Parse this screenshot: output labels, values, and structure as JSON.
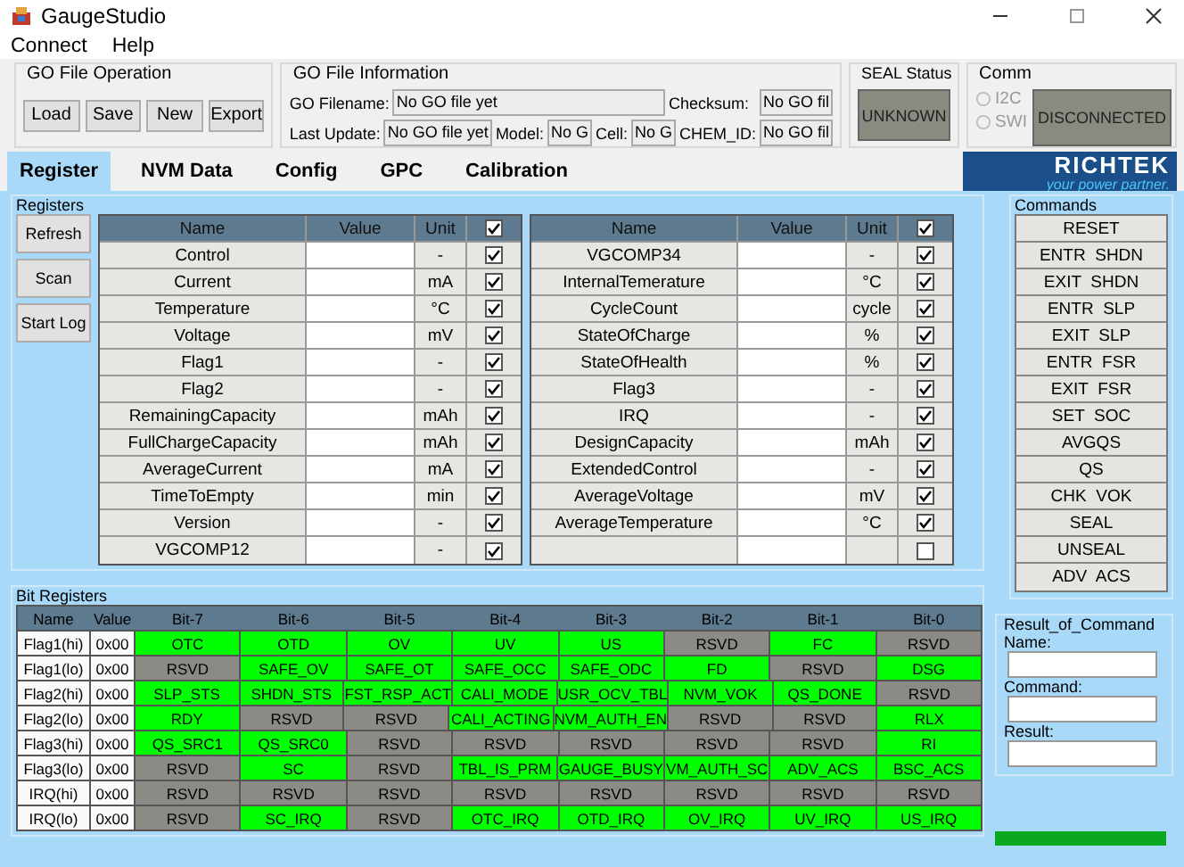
{
  "window": {
    "title": "GaugeStudio"
  },
  "menu": [
    "Connect",
    "Help"
  ],
  "go_file_operation": {
    "title": "GO File Operation",
    "buttons": [
      "Load",
      "Save",
      "New",
      "Export"
    ]
  },
  "go_file_information": {
    "title": "GO File Information",
    "lines": [
      [
        {
          "label": "GO Filename:",
          "value": "No GO file yet"
        },
        {
          "label": "Checksum:",
          "value": "No GO fil"
        }
      ],
      [
        {
          "label": "Last Update:",
          "value": "No GO file yet"
        },
        {
          "label": "Model:",
          "value": "No G"
        },
        {
          "label": "Cell:",
          "value": "No G"
        },
        {
          "label": "CHEM_ID:",
          "value": "No GO fil"
        }
      ]
    ]
  },
  "seal_status": {
    "title": "SEAL Status",
    "value": "UNKNOWN"
  },
  "comm": {
    "title": "Comm",
    "options": [
      {
        "label": "I2C",
        "selected": false,
        "disabled": true
      },
      {
        "label": "SWI",
        "selected": false,
        "disabled": true
      }
    ],
    "status": "DISCONNECTED"
  },
  "tabs": [
    {
      "label": "Register",
      "selected": true
    },
    {
      "label": "NVM Data",
      "selected": false
    },
    {
      "label": "Config",
      "selected": false
    },
    {
      "label": "GPC",
      "selected": false
    },
    {
      "label": "Calibration",
      "selected": false
    }
  ],
  "logo": {
    "name": "RICHTEK",
    "tagline": "your power partner."
  },
  "registers": {
    "title": "Registers",
    "buttons": [
      "Refresh",
      "Scan",
      "Start Log"
    ],
    "tables": [
      {
        "columns": [
          "Name",
          "Value",
          "Unit"
        ],
        "all_checked": true,
        "rows": [
          {
            "name": "Control",
            "unit": "-",
            "checked": true
          },
          {
            "name": "Current",
            "unit": "mA",
            "checked": true
          },
          {
            "name": "Temperature",
            "unit": "°C",
            "checked": true
          },
          {
            "name": "Voltage",
            "unit": "mV",
            "checked": true
          },
          {
            "name": "Flag1",
            "unit": "-",
            "checked": true
          },
          {
            "name": "Flag2",
            "unit": "-",
            "checked": true
          },
          {
            "name": "RemainingCapacity",
            "unit": "mAh",
            "checked": true
          },
          {
            "name": "FullChargeCapacity",
            "unit": "mAh",
            "checked": true
          },
          {
            "name": "AverageCurrent",
            "unit": "mA",
            "checked": true
          },
          {
            "name": "TimeToEmpty",
            "unit": "min",
            "checked": true
          },
          {
            "name": "Version",
            "unit": "-",
            "checked": true
          },
          {
            "name": "VGCOMP12",
            "unit": "-",
            "checked": true
          }
        ]
      },
      {
        "columns": [
          "Name",
          "Value",
          "Unit"
        ],
        "all_checked": true,
        "rows": [
          {
            "name": "VGCOMP34",
            "unit": "-",
            "checked": true
          },
          {
            "name": "InternalTemerature",
            "unit": "°C",
            "checked": true
          },
          {
            "name": "CycleCount",
            "unit": "cycle",
            "checked": true
          },
          {
            "name": "StateOfCharge",
            "unit": "%",
            "checked": true
          },
          {
            "name": "StateOfHealth",
            "unit": "%",
            "checked": true
          },
          {
            "name": "Flag3",
            "unit": "-",
            "checked": true
          },
          {
            "name": "IRQ",
            "unit": "-",
            "checked": true
          },
          {
            "name": "DesignCapacity",
            "unit": "mAh",
            "checked": true
          },
          {
            "name": "ExtendedControl",
            "unit": "-",
            "checked": true
          },
          {
            "name": "AverageVoltage",
            "unit": "mV",
            "checked": true
          },
          {
            "name": "AverageTemperature",
            "unit": "°C",
            "checked": true
          },
          {
            "checked": false
          }
        ]
      }
    ]
  },
  "commands": {
    "title": "Commands",
    "buttons": [
      "RESET",
      "ENTR  SHDN",
      "EXIT  SHDN",
      "ENTR  SLP",
      "EXIT  SLP",
      "ENTR  FSR",
      "EXIT  FSR",
      "SET  SOC",
      "AVGQS",
      "QS",
      "CHK  VOK",
      "SEAL",
      "UNSEAL",
      "ADV  ACS"
    ]
  },
  "bit_registers": {
    "title": "Bit Registers",
    "columns": [
      "Name",
      "Value",
      "Bit-7",
      "Bit-6",
      "Bit-5",
      "Bit-4",
      "Bit-3",
      "Bit-2",
      "Bit-1",
      "Bit-0"
    ],
    "rows": [
      {
        "name": "Flag1(hi)",
        "value": "0x00",
        "bits": [
          {
            "label": "OTC",
            "active": true
          },
          {
            "label": "OTD",
            "active": true
          },
          {
            "label": "OV",
            "active": true
          },
          {
            "label": "UV",
            "active": true
          },
          {
            "label": "US",
            "active": true
          },
          {
            "label": "RSVD",
            "active": false
          },
          {
            "label": "FC",
            "active": true
          },
          {
            "label": "RSVD",
            "active": false
          }
        ]
      },
      {
        "name": "Flag1(lo)",
        "value": "0x00",
        "bits": [
          {
            "label": "RSVD",
            "active": false
          },
          {
            "label": "SAFE_OV",
            "active": true
          },
          {
            "label": "SAFE_OT",
            "active": true
          },
          {
            "label": "SAFE_OCC",
            "active": true
          },
          {
            "label": "SAFE_ODC",
            "active": true
          },
          {
            "label": "FD",
            "active": true
          },
          {
            "label": "RSVD",
            "active": false
          },
          {
            "label": "DSG",
            "active": true
          }
        ]
      },
      {
        "name": "Flag2(hi)",
        "value": "0x00",
        "bits": [
          {
            "label": "SLP_STS",
            "active": true
          },
          {
            "label": "SHDN_STS",
            "active": true
          },
          {
            "label": "FST_RSP_ACT",
            "active": true
          },
          {
            "label": "CALI_MODE",
            "active": true
          },
          {
            "label": "USR_OCV_TBL",
            "active": true
          },
          {
            "label": "NVM_VOK",
            "active": true
          },
          {
            "label": "QS_DONE",
            "active": true
          },
          {
            "label": "RSVD",
            "active": false
          }
        ]
      },
      {
        "name": "Flag2(lo)",
        "value": "0x00",
        "bits": [
          {
            "label": "RDY",
            "active": true
          },
          {
            "label": "RSVD",
            "active": false
          },
          {
            "label": "RSVD",
            "active": false
          },
          {
            "label": "CALI_ACTING",
            "active": true
          },
          {
            "label": "NVM_AUTH_EN",
            "active": true
          },
          {
            "label": "RSVD",
            "active": false
          },
          {
            "label": "RSVD",
            "active": false
          },
          {
            "label": "RLX",
            "active": true
          }
        ]
      },
      {
        "name": "Flag3(hi)",
        "value": "0x00",
        "bits": [
          {
            "label": "QS_SRC1",
            "active": true
          },
          {
            "label": "QS_SRC0",
            "active": true
          },
          {
            "label": "RSVD",
            "active": false
          },
          {
            "label": "RSVD",
            "active": false
          },
          {
            "label": "RSVD",
            "active": false
          },
          {
            "label": "RSVD",
            "active": false
          },
          {
            "label": "RSVD",
            "active": false
          },
          {
            "label": "RI",
            "active": true
          }
        ]
      },
      {
        "name": "Flag3(lo)",
        "value": "0x00",
        "bits": [
          {
            "label": "RSVD",
            "active": false
          },
          {
            "label": "SC",
            "active": true
          },
          {
            "label": "RSVD",
            "active": false
          },
          {
            "label": "TBL_IS_PRM",
            "active": true
          },
          {
            "label": "GAUGE_BUSY",
            "active": true
          },
          {
            "label": "VM_AUTH_SC",
            "active": true
          },
          {
            "label": "ADV_ACS",
            "active": true
          },
          {
            "label": "BSC_ACS",
            "active": true
          }
        ]
      },
      {
        "name": "IRQ(hi)",
        "value": "0x00",
        "bits": [
          {
            "label": "RSVD",
            "active": false
          },
          {
            "label": "RSVD",
            "active": false
          },
          {
            "label": "RSVD",
            "active": false
          },
          {
            "label": "RSVD",
            "active": false
          },
          {
            "label": "RSVD",
            "active": false
          },
          {
            "label": "RSVD",
            "active": false
          },
          {
            "label": "RSVD",
            "active": false
          },
          {
            "label": "RSVD",
            "active": false
          }
        ]
      },
      {
        "name": "IRQ(lo)",
        "value": "0x00",
        "bits": [
          {
            "label": "RSVD",
            "active": false
          },
          {
            "label": "SC_IRQ",
            "active": true
          },
          {
            "label": "RSVD",
            "active": false
          },
          {
            "label": "OTC_IRQ",
            "active": true
          },
          {
            "label": "OTD_IRQ",
            "active": true
          },
          {
            "label": "OV_IRQ",
            "active": true
          },
          {
            "label": "UV_IRQ",
            "active": true
          },
          {
            "label": "US_IRQ",
            "active": true
          }
        ]
      }
    ]
  },
  "result_of_command": {
    "title": "Result_of_Command",
    "fields": [
      "Name:",
      "Command:",
      "Result:"
    ]
  },
  "progress": {
    "level": 1
  }
}
